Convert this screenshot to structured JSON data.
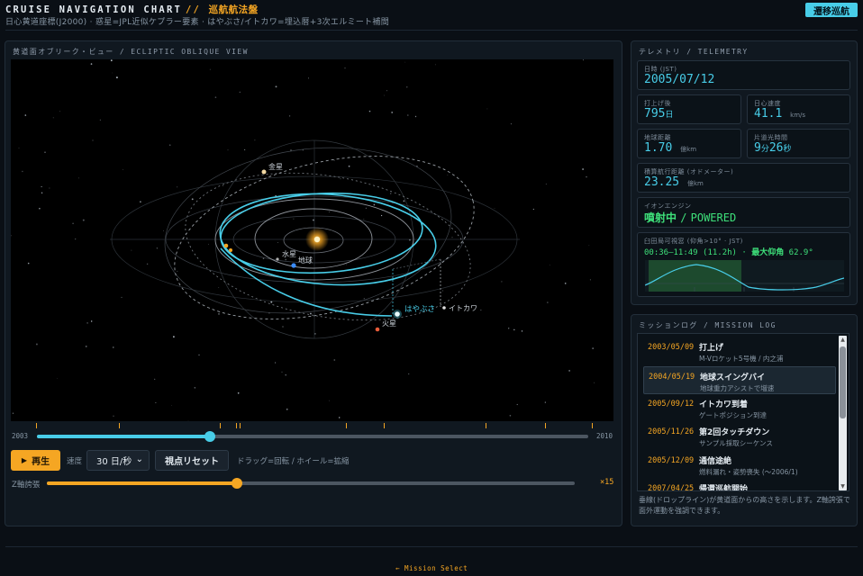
{
  "header": {
    "title": "CRUISE NAVIGATION CHART",
    "separator": "//",
    "title_jp": "巡航航法盤",
    "subtitle": "日心黄道座標(J2000) · 惑星=JPL近似ケプラー要素 · はやぶさ/イトカワ=埋込暦+3次エルミート補間",
    "mode_button": "遷移巡航"
  },
  "view": {
    "panel_title": "黄道面オブリーク・ビュー / ECLIPTIC OBLIQUE VIEW",
    "labels": {
      "venus": "金星",
      "mercury": "水星",
      "earth": "地球",
      "hayabusa": "はやぶさ",
      "itokawa": "イトカワ",
      "mars": "火星"
    }
  },
  "timeline": {
    "start_label": "2003",
    "end_label": "2010",
    "progress": 0.313
  },
  "controls": {
    "play_icon": "▶",
    "play_label": "再生",
    "speed_label": "速度",
    "speed_value": "30 日/秒",
    "speed_chevron": "⌄",
    "reset_label": "視点リセット",
    "hint": "ドラッグ=回転 / ホイール=拡縮",
    "z_label": "Z軸誇張",
    "z_value": "×15",
    "z_progress": 0.36
  },
  "telemetry": {
    "panel_title": "テレメトリ / TELEMETRY",
    "date": {
      "label": "日時 (JST)",
      "value": "2005/07/12"
    },
    "since_launch": {
      "label": "打上げ後",
      "value": "795",
      "unit": "日"
    },
    "helio_speed": {
      "label": "日心速度",
      "value": "41.1",
      "unit": "km/s"
    },
    "earth_distance": {
      "label": "地球距離",
      "value": "1.70",
      "unit": "億km"
    },
    "light_time": {
      "label": "片道光時間",
      "min": "9",
      "min_unit": "分",
      "sec": "26",
      "sec_unit": "秒"
    },
    "odometer": {
      "label": "積算航行距離 (オドメーター)",
      "value": "23.25",
      "unit": "億km"
    },
    "engine": {
      "label": "イオンエンジン",
      "value_jp": "噴射中",
      "value_sep": "/",
      "value_en": "POWERED"
    },
    "visibility": {
      "label": "臼田局可視窓 (仰角>10° · JST)",
      "window": "00:36–11:49 (11.2h)",
      "sep": "·",
      "max_label": "最大仰角",
      "max_value": "62.9°"
    }
  },
  "log": {
    "panel_title": "ミッションログ / MISSION LOG",
    "items": [
      {
        "date": "2003/05/09",
        "title": "打上げ",
        "desc": "M-Vロケット5号機 / 内之浦"
      },
      {
        "date": "2004/05/19",
        "title": "地球スイングバイ",
        "desc": "地球重力アシストで増速"
      },
      {
        "date": "2005/09/12",
        "title": "イトカワ到着",
        "desc": "ゲートポジション到達"
      },
      {
        "date": "2005/11/26",
        "title": "第2回タッチダウン",
        "desc": "サンプル採取シーケンス"
      },
      {
        "date": "2005/12/09",
        "title": "通信途絶",
        "desc": "燃料漏れ・姿勢喪失 (〜2006/1)"
      },
      {
        "date": "2007/04/25",
        "title": "帰還巡航開始",
        "desc": ""
      }
    ],
    "note": "垂線(ドロップライン)が黄道面からの高さを示します。Z軸誇張で面外運動を強調できます。"
  },
  "footer": {
    "back_link": "← Mission Select"
  },
  "colors": {
    "accent_cyan": "#48cde8",
    "accent_orange": "#f5a623",
    "status_green": "#3ee07a",
    "background": "#0a0f15"
  }
}
